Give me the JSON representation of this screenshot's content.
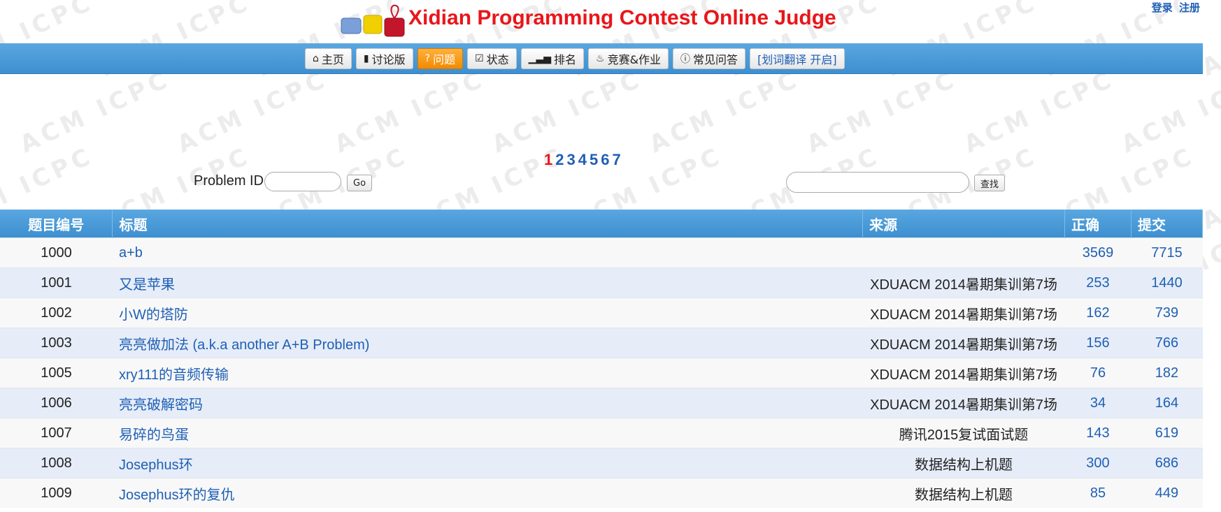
{
  "header": {
    "title": "Xidian Programming Contest Online Judge",
    "login": "登录",
    "register": "注册"
  },
  "watermark": "ACM ICPC",
  "nav": [
    {
      "icon": "home-icon",
      "glyph": "⌂",
      "label": "主页"
    },
    {
      "icon": "chat-icon",
      "glyph": "▮",
      "label": "讨论版"
    },
    {
      "icon": "question-icon",
      "glyph": "?",
      "label": "问题"
    },
    {
      "icon": "checkbox-icon",
      "glyph": "☑",
      "label": "状态"
    },
    {
      "icon": "signal-icon",
      "glyph": "▁▃▅",
      "label": "排名"
    },
    {
      "icon": "fire-icon",
      "glyph": "♨",
      "label": "竞赛&作业"
    },
    {
      "icon": "info-icon",
      "glyph": "ⓘ",
      "label": "常见问答"
    },
    {
      "icon": "",
      "glyph": "",
      "label": "[划词翻译 开启]"
    }
  ],
  "pagination": {
    "pages": [
      "1",
      "2",
      "3",
      "4",
      "5",
      "6",
      "7"
    ],
    "current": "1"
  },
  "search": {
    "problem_id_label": "Problem ID",
    "go_label": "Go",
    "find_label": "查找"
  },
  "table": {
    "headers": {
      "id": "题目编号",
      "title": "标题",
      "source": "来源",
      "accepted": "正确",
      "submitted": "提交"
    },
    "rows": [
      {
        "id": "1000",
        "title": "a+b",
        "source": "",
        "accepted": "3569",
        "submitted": "7715"
      },
      {
        "id": "1001",
        "title": "又是苹果",
        "source": "XDUACM 2014暑期集训第7场",
        "accepted": "253",
        "submitted": "1440"
      },
      {
        "id": "1002",
        "title": "小W的塔防",
        "source": "XDUACM 2014暑期集训第7场",
        "accepted": "162",
        "submitted": "739"
      },
      {
        "id": "1003",
        "title": "亮亮做加法 (a.k.a another A+B Problem)",
        "source": "XDUACM 2014暑期集训第7场",
        "accepted": "156",
        "submitted": "766"
      },
      {
        "id": "1005",
        "title": "xry111的音频传输",
        "source": "XDUACM 2014暑期集训第7场",
        "accepted": "76",
        "submitted": "182"
      },
      {
        "id": "1006",
        "title": "亮亮破解密码",
        "source": "XDUACM 2014暑期集训第7场",
        "accepted": "34",
        "submitted": "164"
      },
      {
        "id": "1007",
        "title": "易碎的鸟蛋",
        "source": "腾讯2015复试面试题",
        "accepted": "143",
        "submitted": "619"
      },
      {
        "id": "1008",
        "title": "Josephus环",
        "source": "数据结构上机题",
        "accepted": "300",
        "submitted": "686"
      },
      {
        "id": "1009",
        "title": "Josephus环的复仇",
        "source": "数据结构上机题",
        "accepted": "85",
        "submitted": "449"
      }
    ]
  }
}
